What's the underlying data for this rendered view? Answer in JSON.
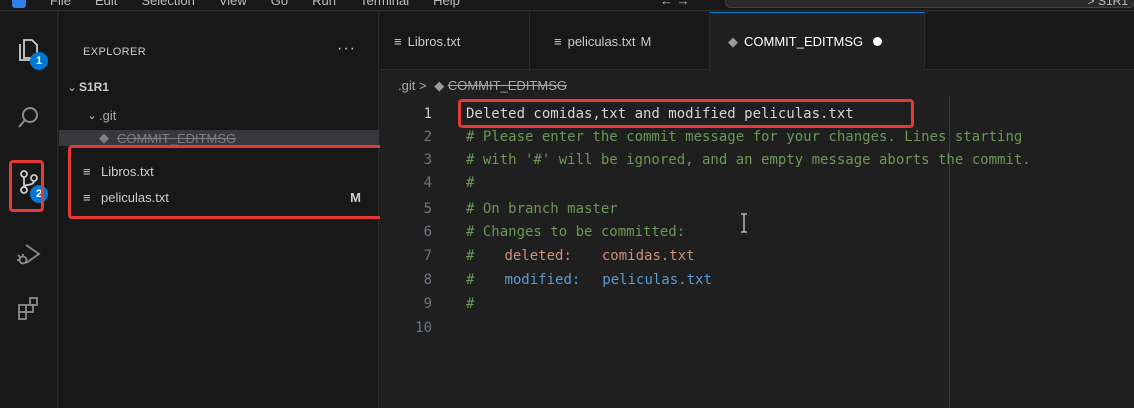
{
  "titlebar": {
    "menu": [
      "File",
      "Edit",
      "Selection",
      "View",
      "Go",
      "Run",
      "Terminal",
      "Help"
    ],
    "nav": "← →",
    "search_text": "> S1R1"
  },
  "activitybar": {
    "explorer_badge": "1",
    "scm_badge": "2"
  },
  "sidebar": {
    "header": "EXPLORER",
    "more": "···",
    "root": "S1R1",
    "git_folder": ".git",
    "commit_file": "COMMIT_EDITMSG",
    "files": [
      {
        "name": "Libros.txt",
        "status": ""
      },
      {
        "name": "peliculas.txt",
        "status": "M"
      }
    ]
  },
  "tabs": [
    {
      "label": "Libros.txt",
      "mod": ""
    },
    {
      "label": "peliculas.txt",
      "mod": "M"
    },
    {
      "label": "COMMIT_EDITMSG",
      "mod": ""
    }
  ],
  "breadcrumb": {
    "folder": ".git",
    "sep": ">",
    "file": "COMMIT_EDITMSG"
  },
  "editor": {
    "lines": [
      {
        "n": "1",
        "text": "Deleted comidas,txt and modified peliculas.txt"
      },
      {
        "n": "2",
        "text": "# Please enter the commit message for your changes. Lines starting"
      },
      {
        "n": "3",
        "text": "# with '#' will be ignored, and an empty message aborts the commit."
      },
      {
        "n": "4",
        "text": "#"
      },
      {
        "n": "5",
        "text": "# On branch master"
      },
      {
        "n": "6",
        "text": "# Changes to be committed:"
      },
      {
        "n": "7",
        "hash": "#",
        "kind": "deleted:",
        "file": "comidas.txt"
      },
      {
        "n": "8",
        "hash": "#",
        "kind": "modified:",
        "file": "peliculas.txt"
      },
      {
        "n": "9",
        "text": "#"
      },
      {
        "n": "10",
        "text": ""
      }
    ]
  },
  "colors": {
    "accent": "#0078d4",
    "highlight": "#e53935",
    "comment": "#6a9955",
    "deleted": "#ce9178",
    "modified": "#569cd6"
  }
}
